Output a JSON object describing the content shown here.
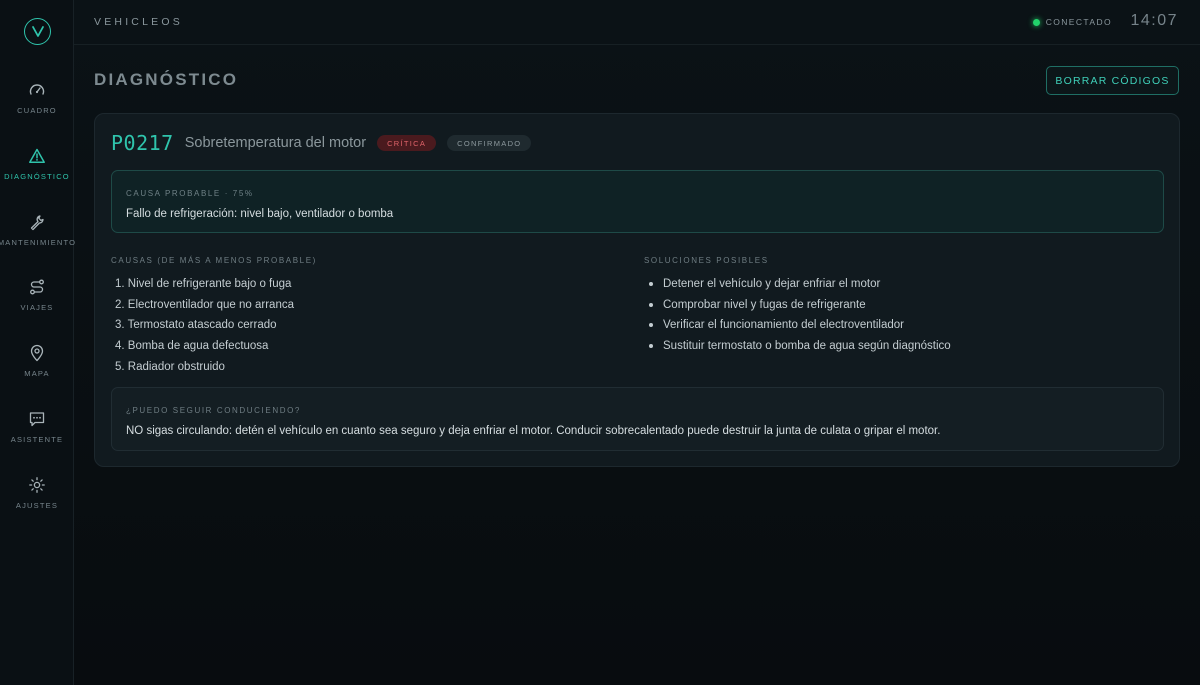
{
  "app": {
    "brand": "VEHICLEOS",
    "status": "CONECTADO",
    "clock": "14:07"
  },
  "sidebar": {
    "items": [
      {
        "label": "CUADRO",
        "icon": "gauge-icon",
        "active": false
      },
      {
        "label": "DIAGNÓSTICO",
        "icon": "warning-icon",
        "active": true
      },
      {
        "label": "MANTENIMIENTO",
        "icon": "wrench-icon",
        "active": false
      },
      {
        "label": "VIAJES",
        "icon": "route-icon",
        "active": false
      },
      {
        "label": "MAPA",
        "icon": "map-pin-icon",
        "active": false
      },
      {
        "label": "ASISTENTE",
        "icon": "chat-icon",
        "active": false
      },
      {
        "label": "AJUSTES",
        "icon": "gear-icon",
        "active": false
      }
    ]
  },
  "page": {
    "title": "DIAGNÓSTICO",
    "clear_button": "BORRAR CÓDIGOS"
  },
  "dtc": {
    "code": "P0217",
    "description": "Sobretemperatura del motor",
    "severity": "CRÍTICA",
    "state": "CONFIRMADO",
    "probable_cause": {
      "title": "CAUSA PROBABLE · 75%",
      "text": "Fallo de refrigeración: nivel bajo, ventilador o bomba"
    },
    "causes": {
      "title": "CAUSAS (DE MÁS A MENOS PROBABLE)",
      "items": [
        "1. Nivel de refrigerante bajo o fuga",
        "2. Electroventilador que no arranca",
        "3. Termostato atascado cerrado",
        "4. Bomba de agua defectuosa",
        "5. Radiador obstruido"
      ]
    },
    "solutions": {
      "title": "SOLUCIONES POSIBLES",
      "items": [
        "Detener el vehículo y dejar enfriar el motor",
        "Comprobar nivel y fugas de refrigerante",
        "Verificar el funcionamiento del electroventilador",
        "Sustituir termostato o bomba de agua según diagnóstico"
      ]
    },
    "can_drive": {
      "title": "¿PUEDO SEGUIR CONDUCIENDO?",
      "text": "NO sigas circulando: detén el vehículo en cuanto sea seguro y deja enfriar el motor. Conducir sobrecalentado puede destruir la junta de culata o gripar el motor."
    }
  },
  "colors": {
    "accent": "#2fc4ac",
    "critical": "#e0646a",
    "connected": "#22d36b"
  }
}
